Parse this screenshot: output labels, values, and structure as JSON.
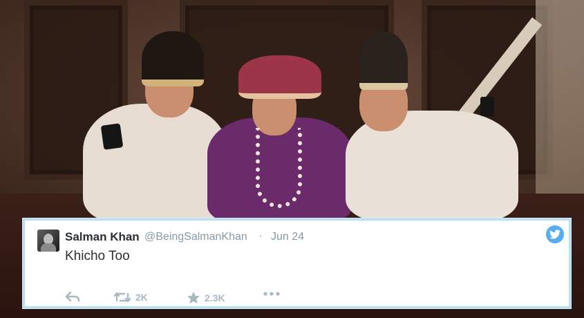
{
  "tweet": {
    "name": "Salman Khan",
    "handle": "@BeingSalmanKhan",
    "separator": "·",
    "date": "Jun 24",
    "text": "Khicho Too",
    "retweets": "2K",
    "favorites": "2.3K"
  },
  "icons": {
    "avatar": "user-avatar",
    "brand": "twitter-bird-icon",
    "reply": "reply-icon",
    "retweet": "retweet-icon",
    "favorite": "star-icon",
    "more": "more-dots-icon"
  },
  "colors": {
    "brand": "#55acee",
    "card_border": "#b7e0f4",
    "muted": "#8899a6",
    "text": "#292f33"
  }
}
